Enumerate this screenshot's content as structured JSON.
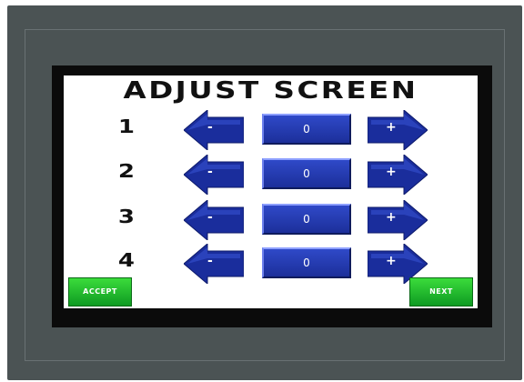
{
  "screen": {
    "title": "ADJUST SCREEN"
  },
  "rows": [
    {
      "label": "1",
      "value": "0",
      "minus": "-",
      "plus": "+"
    },
    {
      "label": "2",
      "value": "0",
      "minus": "-",
      "plus": "+"
    },
    {
      "label": "3",
      "value": "0",
      "minus": "-",
      "plus": "+"
    },
    {
      "label": "4",
      "value": "0",
      "minus": "-",
      "plus": "+"
    }
  ],
  "buttons": {
    "accept": "ACCEPT",
    "next": "NEXT"
  },
  "colors": {
    "bezel": "#4b5354",
    "arrow_blue": "#1a2d9c",
    "value_blue": "#2740b8",
    "button_green": "#22c232"
  }
}
